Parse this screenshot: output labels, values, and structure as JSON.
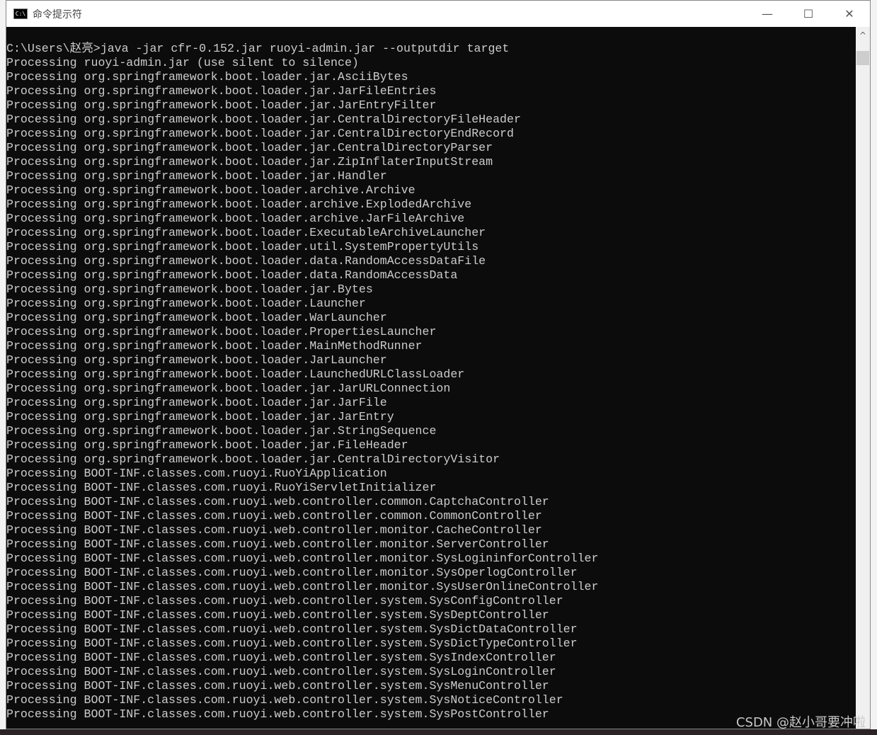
{
  "window": {
    "title": "命令提示符",
    "icon": "cmd-icon"
  },
  "controls": {
    "minimize": "—",
    "maximize": "☐",
    "close": "✕"
  },
  "console": {
    "background": "#0c0c0c",
    "foreground": "#cccccc",
    "lines": [
      "C:\\Users\\赵亮>java -jar cfr-0.152.jar ruoyi-admin.jar --outputdir target",
      "Processing ruoyi-admin.jar (use silent to silence)",
      "Processing org.springframework.boot.loader.jar.AsciiBytes",
      "Processing org.springframework.boot.loader.jar.JarFileEntries",
      "Processing org.springframework.boot.loader.jar.JarEntryFilter",
      "Processing org.springframework.boot.loader.jar.CentralDirectoryFileHeader",
      "Processing org.springframework.boot.loader.jar.CentralDirectoryEndRecord",
      "Processing org.springframework.boot.loader.jar.CentralDirectoryParser",
      "Processing org.springframework.boot.loader.jar.ZipInflaterInputStream",
      "Processing org.springframework.boot.loader.jar.Handler",
      "Processing org.springframework.boot.loader.archive.Archive",
      "Processing org.springframework.boot.loader.archive.ExplodedArchive",
      "Processing org.springframework.boot.loader.archive.JarFileArchive",
      "Processing org.springframework.boot.loader.ExecutableArchiveLauncher",
      "Processing org.springframework.boot.loader.util.SystemPropertyUtils",
      "Processing org.springframework.boot.loader.data.RandomAccessDataFile",
      "Processing org.springframework.boot.loader.data.RandomAccessData",
      "Processing org.springframework.boot.loader.jar.Bytes",
      "Processing org.springframework.boot.loader.Launcher",
      "Processing org.springframework.boot.loader.WarLauncher",
      "Processing org.springframework.boot.loader.PropertiesLauncher",
      "Processing org.springframework.boot.loader.MainMethodRunner",
      "Processing org.springframework.boot.loader.JarLauncher",
      "Processing org.springframework.boot.loader.LaunchedURLClassLoader",
      "Processing org.springframework.boot.loader.jar.JarURLConnection",
      "Processing org.springframework.boot.loader.jar.JarFile",
      "Processing org.springframework.boot.loader.jar.JarEntry",
      "Processing org.springframework.boot.loader.jar.StringSequence",
      "Processing org.springframework.boot.loader.jar.FileHeader",
      "Processing org.springframework.boot.loader.jar.CentralDirectoryVisitor",
      "Processing BOOT-INF.classes.com.ruoyi.RuoYiApplication",
      "Processing BOOT-INF.classes.com.ruoyi.RuoYiServletInitializer",
      "Processing BOOT-INF.classes.com.ruoyi.web.controller.common.CaptchaController",
      "Processing BOOT-INF.classes.com.ruoyi.web.controller.common.CommonController",
      "Processing BOOT-INF.classes.com.ruoyi.web.controller.monitor.CacheController",
      "Processing BOOT-INF.classes.com.ruoyi.web.controller.monitor.ServerController",
      "Processing BOOT-INF.classes.com.ruoyi.web.controller.monitor.SysLogininforController",
      "Processing BOOT-INF.classes.com.ruoyi.web.controller.monitor.SysOperlogController",
      "Processing BOOT-INF.classes.com.ruoyi.web.controller.monitor.SysUserOnlineController",
      "Processing BOOT-INF.classes.com.ruoyi.web.controller.system.SysConfigController",
      "Processing BOOT-INF.classes.com.ruoyi.web.controller.system.SysDeptController",
      "Processing BOOT-INF.classes.com.ruoyi.web.controller.system.SysDictDataController",
      "Processing BOOT-INF.classes.com.ruoyi.web.controller.system.SysDictTypeController",
      "Processing BOOT-INF.classes.com.ruoyi.web.controller.system.SysIndexController",
      "Processing BOOT-INF.classes.com.ruoyi.web.controller.system.SysLoginController",
      "Processing BOOT-INF.classes.com.ruoyi.web.controller.system.SysMenuController",
      "Processing BOOT-INF.classes.com.ruoyi.web.controller.system.SysNoticeController",
      "Processing BOOT-INF.classes.com.ruoyi.web.controller.system.SysPostController"
    ]
  },
  "scrollbar": {
    "up_arrow": "^"
  },
  "watermark": "CSDN @赵小哥要冲啦"
}
